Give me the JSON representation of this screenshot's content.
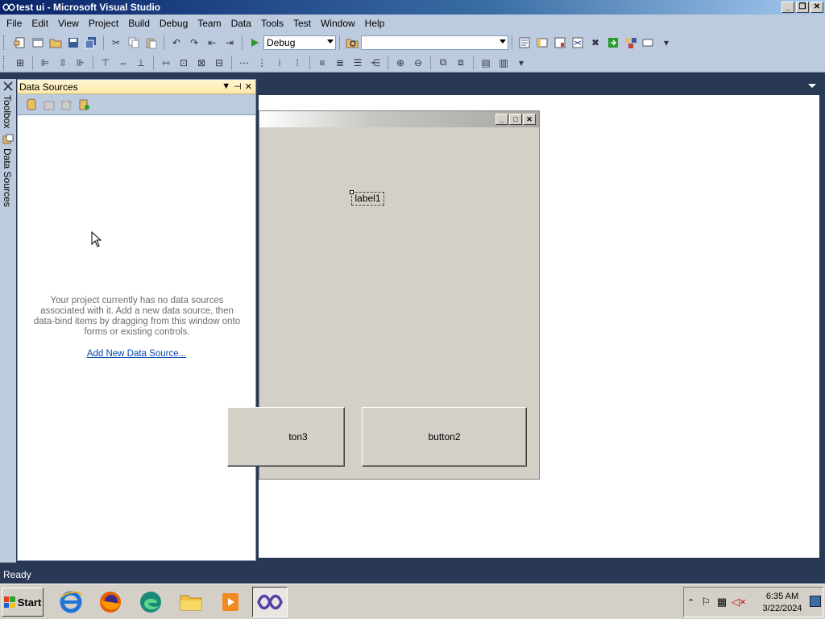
{
  "window": {
    "title": "test ui - Microsoft Visual Studio",
    "buttons": [
      "_",
      "❐",
      "✕"
    ]
  },
  "menu": [
    "File",
    "Edit",
    "View",
    "Project",
    "Build",
    "Debug",
    "Team",
    "Data",
    "Tools",
    "Test",
    "Window",
    "Help"
  ],
  "toolbar": {
    "config_value": "Debug",
    "search_value": ""
  },
  "sidebar_tabs": {
    "toolbox": "Toolbox",
    "data_sources": "Data Sources"
  },
  "data_sources": {
    "title": "Data Sources",
    "message": "Your project currently has no data sources associated with it. Add a new data source, then data-bind items by dragging from this window onto forms or existing controls.",
    "link": "Add New Data Source..."
  },
  "designer": {
    "label1": "label1",
    "button3": "ton3",
    "button2": "button2"
  },
  "status": "Ready",
  "taskbar": {
    "start": "Start",
    "time": "6:35 AM",
    "date": "3/22/2024"
  }
}
